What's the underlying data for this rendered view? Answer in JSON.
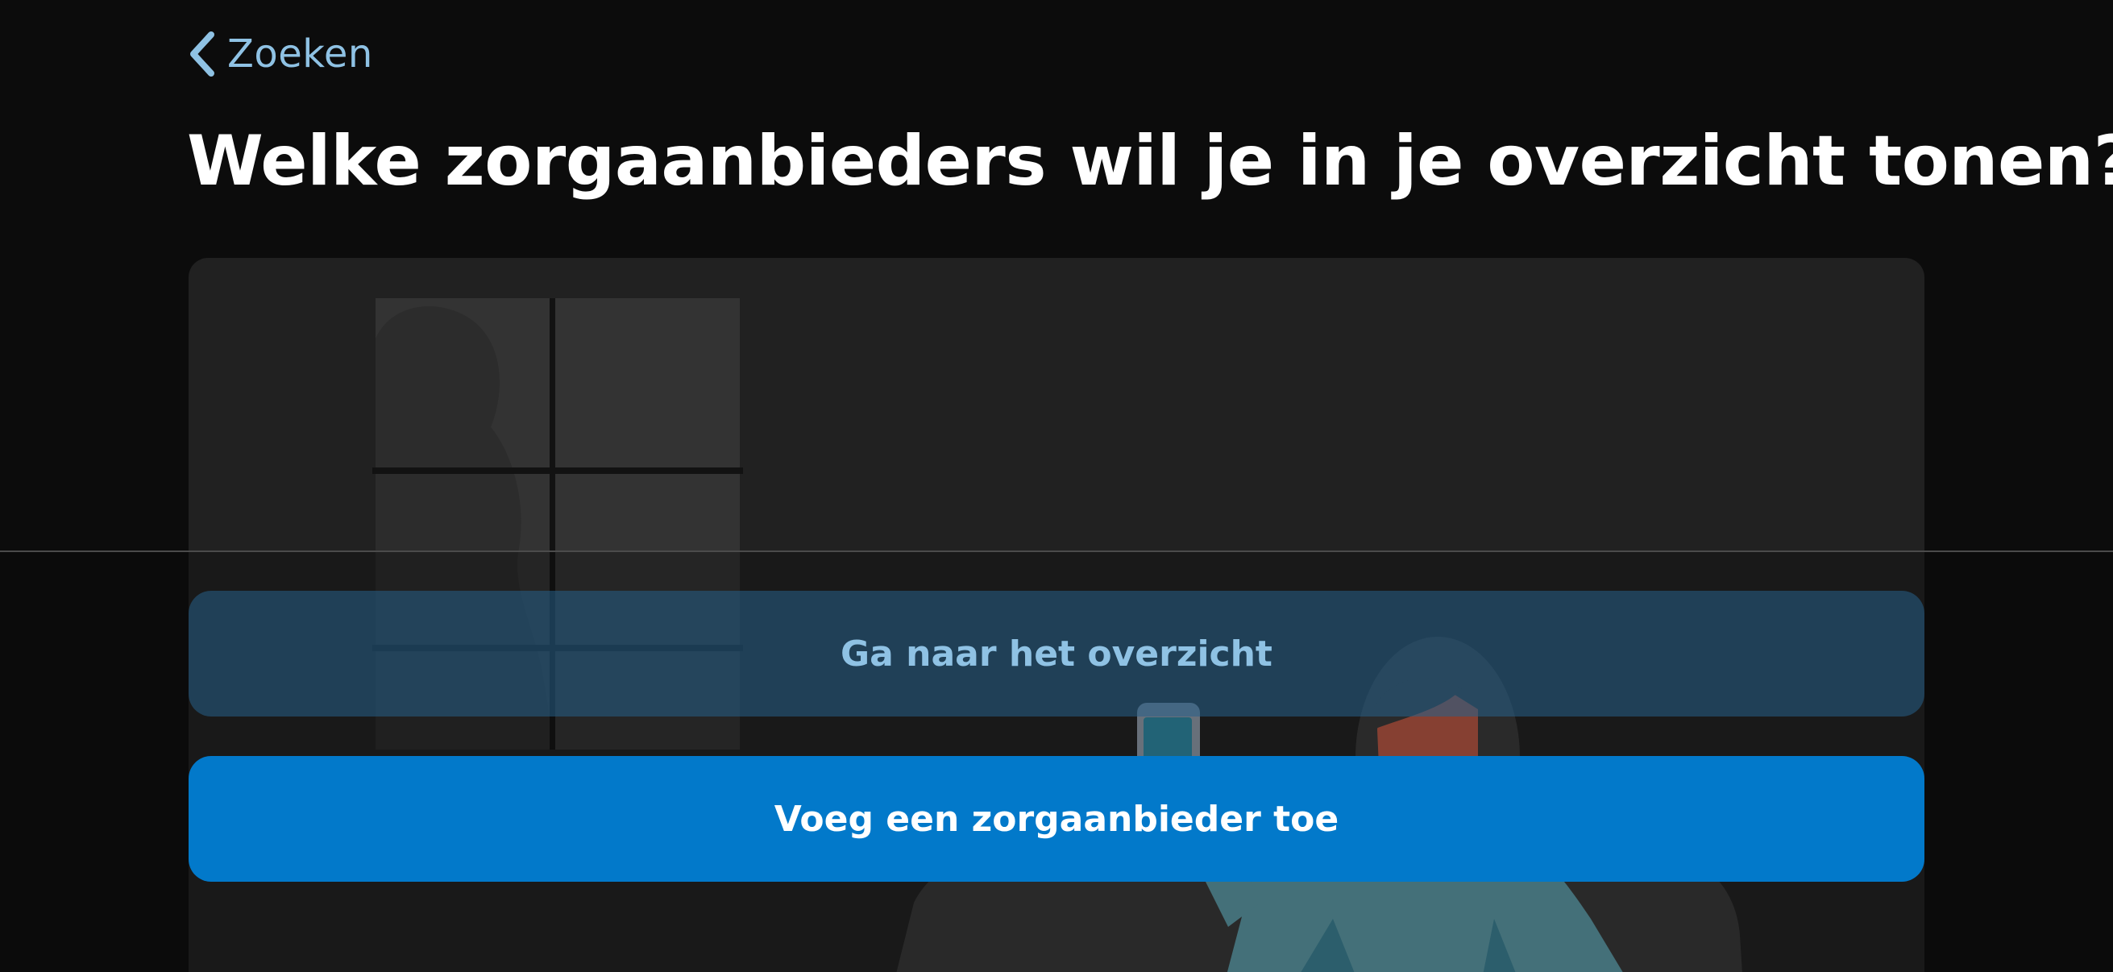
{
  "nav": {
    "back_label": "Zoeken",
    "back_icon": "chevron-left-icon"
  },
  "page": {
    "title": "Welke zorgaanbieders wil je in je overzicht tonen?"
  },
  "actions": {
    "secondary_label": "Ga naar het overzicht",
    "primary_label": "Voeg een zorgaanbieder toe"
  },
  "colors": {
    "background": "#0c0c0c",
    "card": "#212121",
    "link": "#8fc2e4",
    "primary_button": "#0279ca",
    "secondary_button": "#1d3a4f"
  }
}
